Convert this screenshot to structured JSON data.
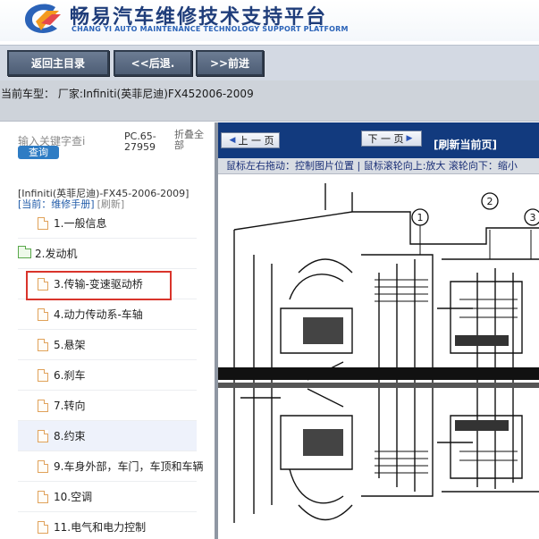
{
  "header": {
    "brand_cn": "畅易汽车维修技术支持平台",
    "brand_en": "CHANG YI AUTO MAINTENANCE TECHNOLOGY SUPPORT PLATFORM",
    "logo_icon": "chang-yi-logo-icon"
  },
  "toolbar": {
    "home_label": "返回主目录",
    "back_label": "<<后退.",
    "forward_label": ">>前进"
  },
  "vehicle": {
    "text": "当前车型： 厂家:Infiniti(英菲尼迪)FX452006-2009"
  },
  "left_panel": {
    "search_placeholder": "输入关键字查i",
    "query_label": "查询",
    "pc_code": "PC.65-27959",
    "collapse_all": "折叠全部",
    "model_line": "[Infiniti(英菲尼迪)-FX45-2006-2009]",
    "current_label": "[当前：维修手册]",
    "refresh_label": "[刷新]",
    "tree": [
      {
        "label": "1.一般信息",
        "icon": "document-icon"
      },
      {
        "label": "2.发动机",
        "icon": "folder-icon"
      },
      {
        "label": "3.传输-变速驱动桥",
        "icon": "document-icon",
        "highlighted_red": true
      },
      {
        "label": "4.动力传动系-车轴",
        "icon": "document-icon"
      },
      {
        "label": "5.悬架",
        "icon": "document-icon"
      },
      {
        "label": "6.刹车",
        "icon": "document-icon"
      },
      {
        "label": "7.转向",
        "icon": "document-icon"
      },
      {
        "label": "8.约束",
        "icon": "document-icon",
        "selected": true
      },
      {
        "label": "9.车身外部，车门，车顶和车辆",
        "icon": "document-icon"
      },
      {
        "label": "10.空调",
        "icon": "document-icon"
      },
      {
        "label": "11.电气和电力控制",
        "icon": "document-icon"
      }
    ]
  },
  "viewer": {
    "prev_label": "上 一 页",
    "next_label": "下 一 页",
    "refresh_page": "[刷新当前页]",
    "hint": "鼠标左右拖动：控制图片位置 | 鼠标滚轮向上:放大   滚轮向下：缩小",
    "callouts": [
      "1",
      "2",
      "3"
    ]
  },
  "colors": {
    "nav_blue": "#123a7e",
    "brand_blue": "#1f3d7a",
    "highlight_red": "#d9342b",
    "toolbar_button": "#5a6a82"
  }
}
